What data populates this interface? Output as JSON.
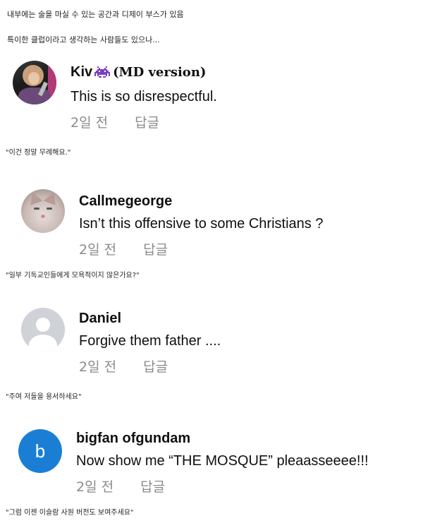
{
  "intro": {
    "line1": "내부에는 술을 마실 수 있는 공간과 디제이 부스가 있음",
    "line2": "특이한 클럽이라고 생각하는 사람들도 있으나..."
  },
  "comments": [
    {
      "author": "Kiv",
      "author_extra": "(MD version)",
      "badge_icon": "space-invader-icon",
      "text": "This is so disrespectful.",
      "time": "2일 전",
      "reply": "답글",
      "translation": "\"이건 정말 무례해요.\""
    },
    {
      "author": "Callmegeorge",
      "text": "Isn’t this offensive to some Christians ?",
      "time": "2일 전",
      "reply": "답글",
      "translation": "\"일부 기독교인들에게 모욕적이지 않은가요?\""
    },
    {
      "author": "Daniel",
      "text": "Forgive them father ....",
      "time": "2일 전",
      "reply": "답글",
      "translation": "\"주여 저들을 용서하세요\""
    },
    {
      "author": "bigfan ofgundam",
      "avatar_letter": "b",
      "text": "Now show me “THE MOSQUE” pleaasseeee!!!",
      "time": "2일 전",
      "reply": "답글",
      "translation": "\"그럼 이젠 이슬람 사원 버전도 보여주세요\""
    }
  ],
  "colors": {
    "meta_gray": "#8a8a8a",
    "badge_purple": "#7b3fc4",
    "letter_avatar_blue": "#1a7fd4"
  }
}
